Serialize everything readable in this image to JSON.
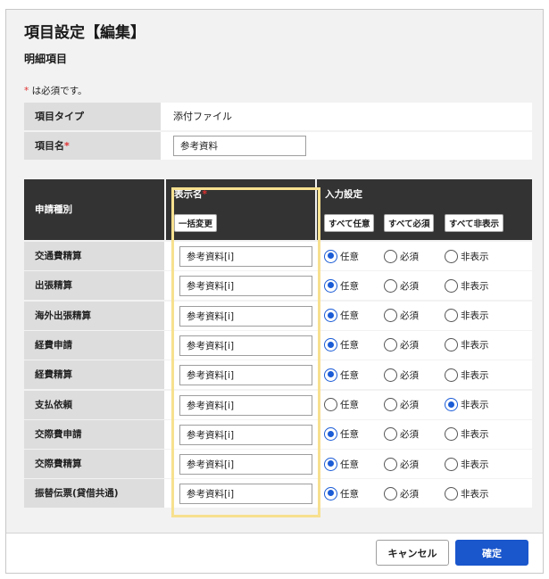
{
  "title": "項目設定【編集】",
  "section": "明細項目",
  "required_note": {
    "mark": "*",
    "text": " は必須です。"
  },
  "item_type": {
    "label": "項目タイプ",
    "value": "添付ファイル"
  },
  "item_name": {
    "label": "項目名",
    "required_mark": "*",
    "value": "参考資料"
  },
  "table": {
    "col_category": "申請種別",
    "col_display_name": "表示名",
    "col_display_required_mark": "*",
    "bulk_change_button": "一括変更",
    "col_input_setting": "入力設定",
    "all_optional_button": "すべて任意",
    "all_required_button": "すべて必須",
    "all_hidden_button": "すべて非表示",
    "option_labels": {
      "optional": "任意",
      "required": "必須",
      "hidden": "非表示"
    },
    "rows": [
      {
        "category": "交通費精算",
        "display_name": "参考資料[i]",
        "selected": "optional"
      },
      {
        "category": "出張精算",
        "display_name": "参考資料[i]",
        "selected": "optional"
      },
      {
        "category": "海外出張精算",
        "display_name": "参考資料[i]",
        "selected": "optional"
      },
      {
        "category": "経費申請",
        "display_name": "参考資料[i]",
        "selected": "optional"
      },
      {
        "category": "経費精算",
        "display_name": "参考資料[i]",
        "selected": "optional"
      },
      {
        "category": "支払依頼",
        "display_name": "参考資料[i]",
        "selected": "hidden"
      },
      {
        "category": "交際費申請",
        "display_name": "参考資料[i]",
        "selected": "optional"
      },
      {
        "category": "交際費精算",
        "display_name": "参考資料[i]",
        "selected": "optional"
      },
      {
        "category": "振替伝票(貸借共通)",
        "display_name": "参考資料[i]",
        "selected": "optional"
      }
    ]
  },
  "footer": {
    "cancel": "キャンセル",
    "confirm": "確定"
  },
  "colors": {
    "accent": "#1a56cc",
    "required": "#e03030",
    "highlight": "#f7e08f",
    "header": "#333333"
  }
}
